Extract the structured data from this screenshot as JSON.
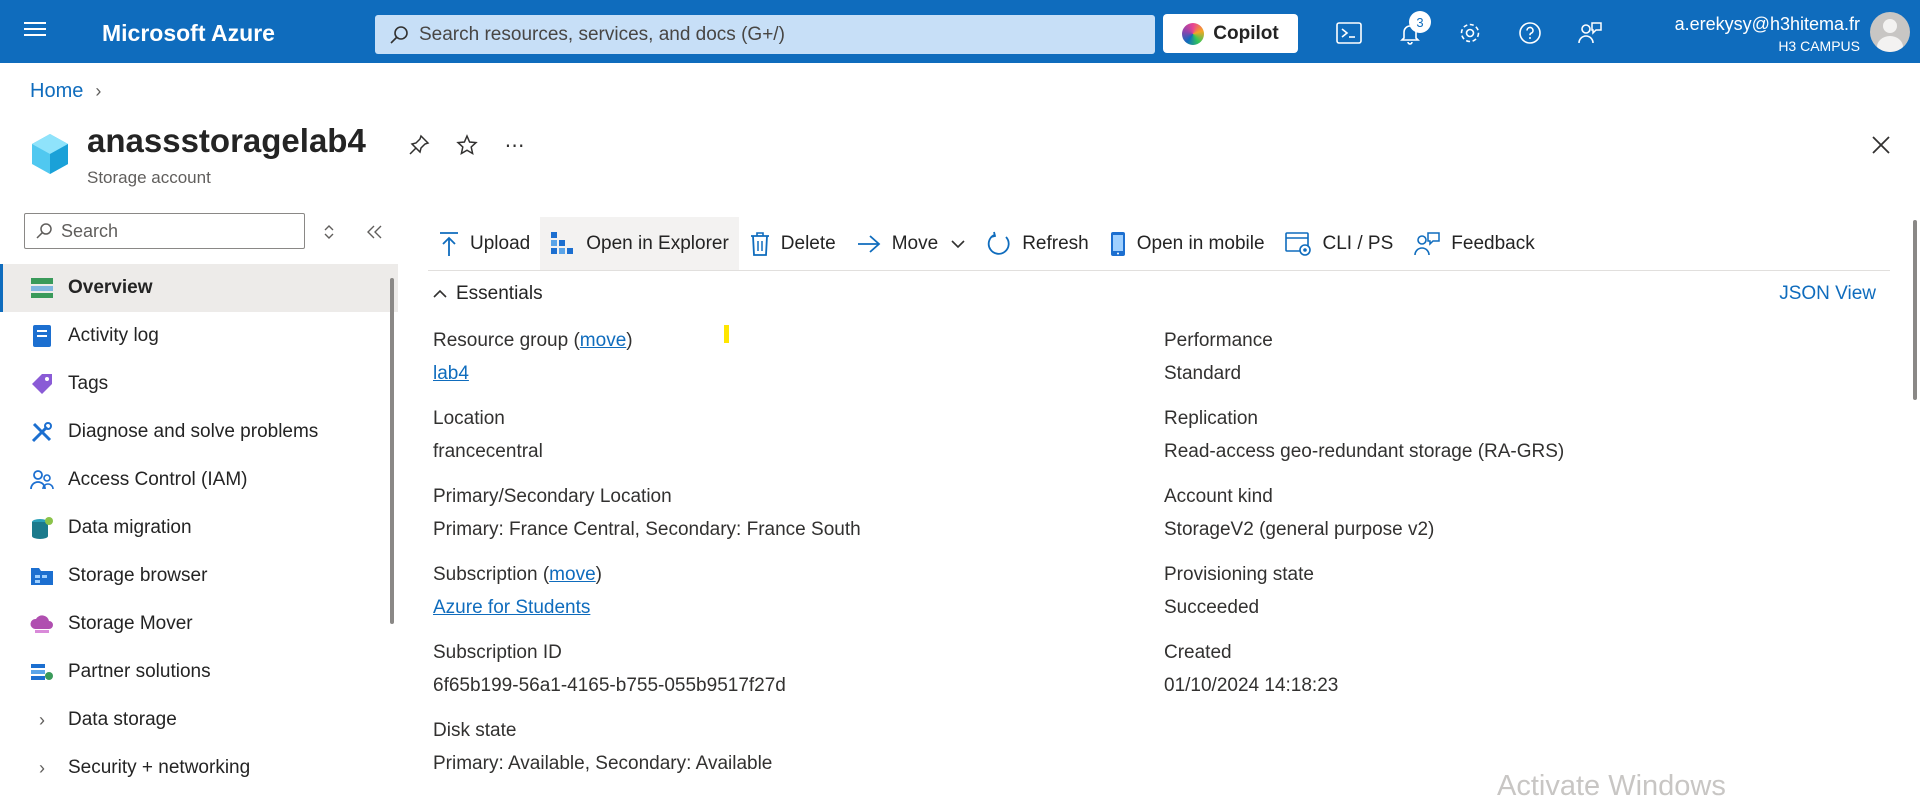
{
  "topbar": {
    "brand": "Microsoft Azure",
    "search_placeholder": "Search resources, services, and docs (G+/)",
    "copilot_label": "Copilot",
    "notifications_count": "3",
    "account_user": "a.erekysy@h3hitema.fr",
    "account_org": "H3 CAMPUS",
    "icons": [
      "menu-icon",
      "search-icon",
      "cloud-shell-icon",
      "bell-icon",
      "gear-icon",
      "help-icon",
      "feedback-icon"
    ]
  },
  "breadcrumb": {
    "home": "Home"
  },
  "resource": {
    "title": "anassstoragelab4",
    "subtitle": "Storage account"
  },
  "nav": {
    "search_placeholder": "Search",
    "items": [
      {
        "label": "Overview",
        "icon": "overview-icon",
        "active": true
      },
      {
        "label": "Activity log",
        "icon": "activity-log-icon"
      },
      {
        "label": "Tags",
        "icon": "tag-icon"
      },
      {
        "label": "Diagnose and solve problems",
        "icon": "wrench-icon"
      },
      {
        "label": "Access Control (IAM)",
        "icon": "people-icon"
      },
      {
        "label": "Data migration",
        "icon": "data-migration-icon"
      },
      {
        "label": "Storage browser",
        "icon": "storage-browser-icon"
      },
      {
        "label": "Storage Mover",
        "icon": "storage-mover-icon"
      },
      {
        "label": "Partner solutions",
        "icon": "partner-icon"
      },
      {
        "label": "Data storage",
        "icon": "chevron-right-icon",
        "group": true
      },
      {
        "label": "Security + networking",
        "icon": "chevron-right-icon",
        "group": true
      }
    ]
  },
  "toolbar": {
    "upload": "Upload",
    "open_explorer": "Open in Explorer",
    "delete": "Delete",
    "move": "Move",
    "refresh": "Refresh",
    "open_mobile": "Open in mobile",
    "cli": "CLI / PS",
    "feedback": "Feedback"
  },
  "essentials": {
    "toggle": "Essentials",
    "json_view": "JSON View",
    "move_link": "move",
    "left": {
      "resource_group_label": "Resource group (",
      "resource_group_label_end": ")",
      "resource_group_value": "lab4",
      "location_label": "Location",
      "location_value": "francecentral",
      "ps_location_label": "Primary/Secondary Location",
      "ps_location_value": "Primary: France Central, Secondary: France South",
      "subscription_label": "Subscription (",
      "subscription_label_end": ")",
      "subscription_value": "Azure for Students",
      "subscription_id_label": "Subscription ID",
      "subscription_id_value": "6f65b199-56a1-4165-b755-055b9517f27d",
      "disk_state_label": "Disk state",
      "disk_state_value": "Primary: Available, Secondary: Available"
    },
    "right": {
      "performance_label": "Performance",
      "performance_value": "Standard",
      "replication_label": "Replication",
      "replication_value": "Read-access geo-redundant storage (RA-GRS)",
      "account_kind_label": "Account kind",
      "account_kind_value": "StorageV2 (general purpose v2)",
      "provisioning_label": "Provisioning state",
      "provisioning_value": "Succeeded",
      "created_label": "Created",
      "created_value": "01/10/2024 14:18:23"
    }
  },
  "watermark": "Activate Windows",
  "colors": {
    "brand": "#0f6cbd",
    "link": "#0f6cbd",
    "active_nav_bg": "#edebe9"
  }
}
